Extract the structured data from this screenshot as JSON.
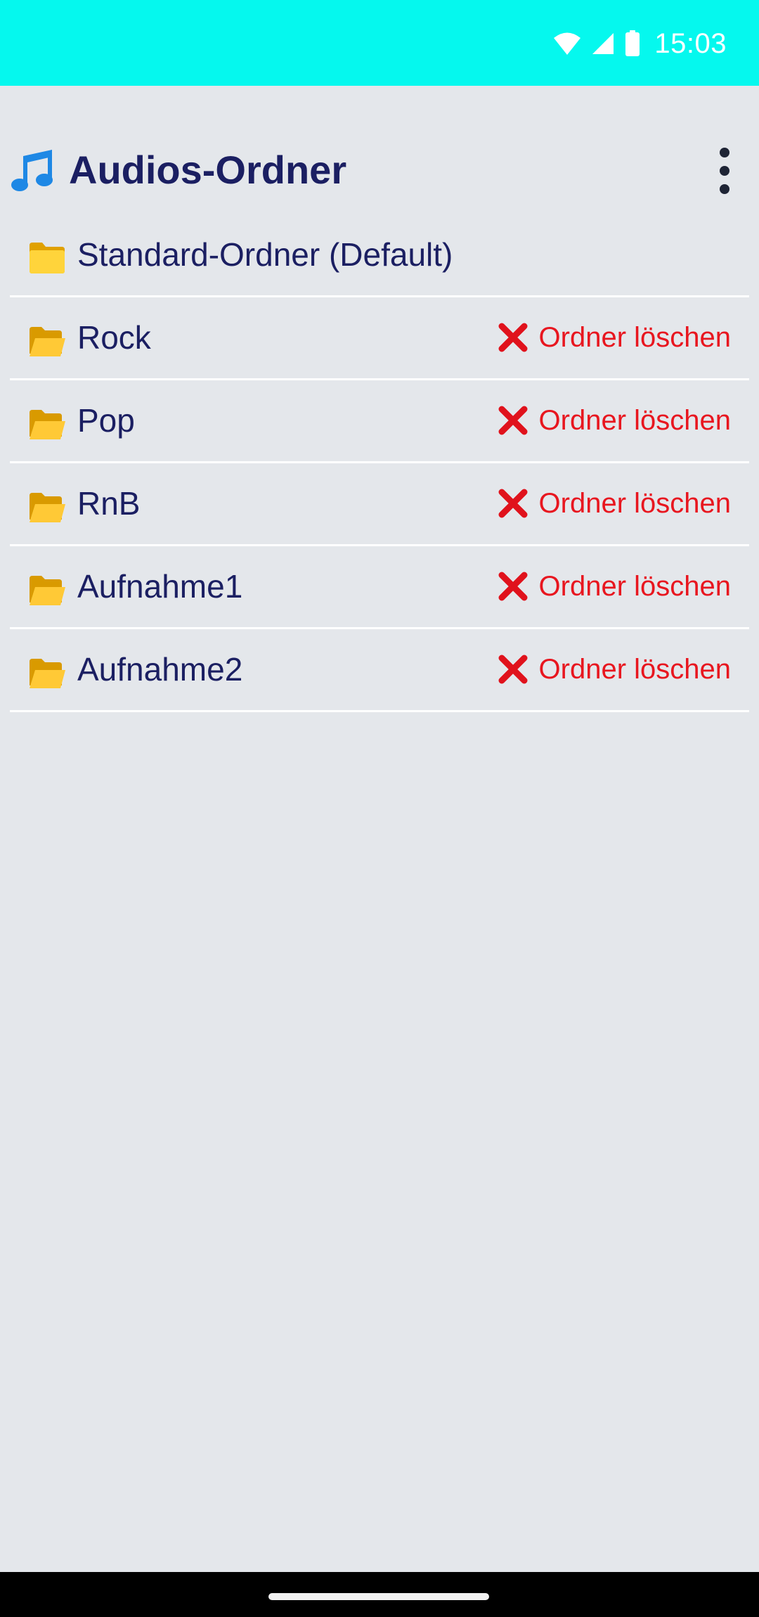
{
  "status_bar": {
    "time": "15:03",
    "background_color": "#05F8EE",
    "icons": [
      "wifi-icon",
      "cell-signal-icon",
      "battery-icon"
    ]
  },
  "header": {
    "title": "Audios-Ordner",
    "icon": "music-note-icon",
    "menu_icon": "more-vert-icon"
  },
  "folders": [
    {
      "name": "Standard-Ordner (Default)",
      "icon": "folder-closed-icon",
      "delete_label": null
    },
    {
      "name": "Rock",
      "icon": "folder-open-icon",
      "delete_label": "Ordner löschen"
    },
    {
      "name": "Pop",
      "icon": "folder-open-icon",
      "delete_label": "Ordner löschen"
    },
    {
      "name": "RnB",
      "icon": "folder-open-icon",
      "delete_label": "Ordner löschen"
    },
    {
      "name": "Aufnahme1",
      "icon": "folder-open-icon",
      "delete_label": "Ordner löschen"
    },
    {
      "name": "Aufnahme2",
      "icon": "folder-open-icon",
      "delete_label": "Ordner löschen"
    }
  ],
  "colors": {
    "title": "#1B1F62",
    "delete_text": "#E8161F",
    "background": "#E4E7EB"
  }
}
